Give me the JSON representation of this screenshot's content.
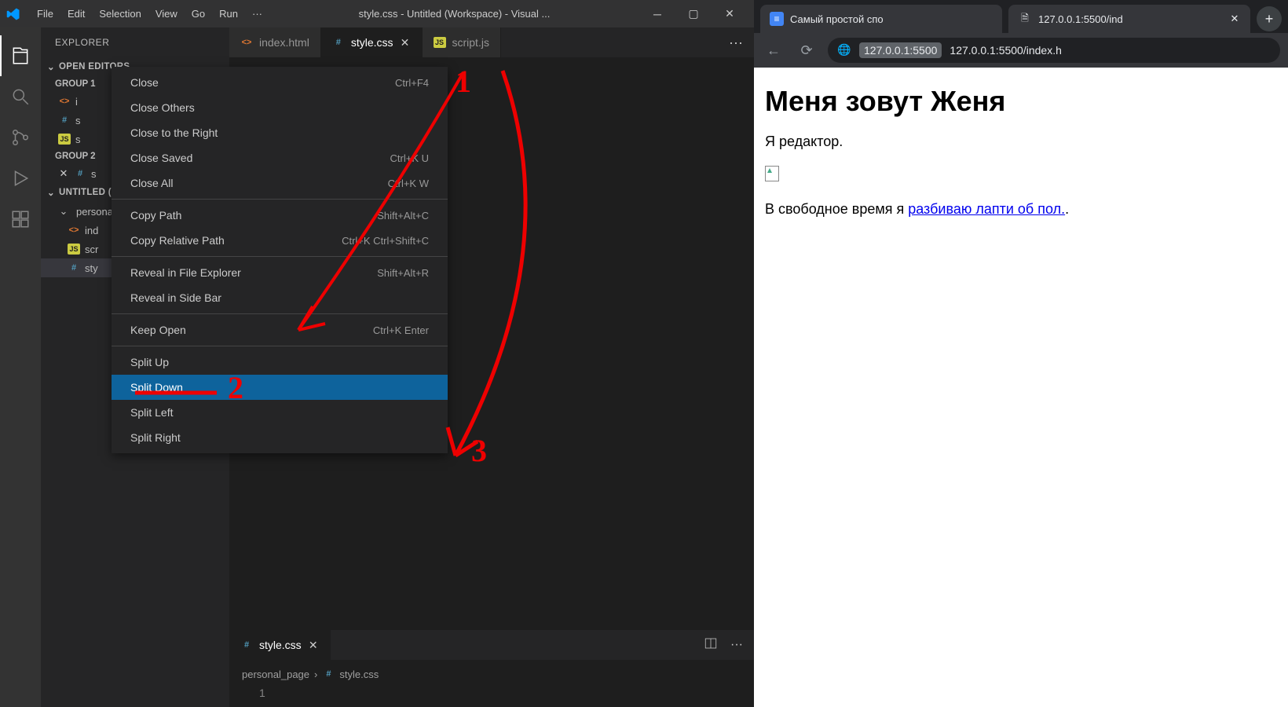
{
  "vscode": {
    "menubar": [
      "File",
      "Edit",
      "Selection",
      "View",
      "Go",
      "Run",
      "···"
    ],
    "title": "style.css - Untitled (Workspace) - Visual ...",
    "sidebar": {
      "title": "EXPLORER",
      "open_editors": "OPEN EDITORS",
      "group1": "GROUP 1",
      "group2": "GROUP 2",
      "workspace": "UNTITLED (WORKSPACE)",
      "folder": "personal_page",
      "files_g1": [
        {
          "name": "index.html",
          "type": "html",
          "short": "i"
        },
        {
          "name": "style.css",
          "type": "css",
          "short": "s"
        },
        {
          "name": "script.js",
          "type": "js",
          "short": "s"
        }
      ],
      "files_g2": [
        {
          "name": "style.css",
          "type": "css",
          "short": "s"
        }
      ],
      "tree": [
        {
          "name": "index.html",
          "type": "html",
          "short": "ind"
        },
        {
          "name": "script.js",
          "type": "js",
          "short": "scr"
        },
        {
          "name": "style.css",
          "type": "css",
          "short": "sty"
        }
      ]
    },
    "tabs": [
      {
        "name": "index.html",
        "type": "html",
        "active": false
      },
      {
        "name": "style.css",
        "type": "css",
        "active": true
      },
      {
        "name": "script.js",
        "type": "js",
        "active": false
      }
    ],
    "context_menu": [
      {
        "label": "Close",
        "shortcut": "Ctrl+F4"
      },
      {
        "label": "Close Others",
        "shortcut": ""
      },
      {
        "label": "Close to the Right",
        "shortcut": ""
      },
      {
        "label": "Close Saved",
        "shortcut": "Ctrl+K U"
      },
      {
        "label": "Close All",
        "shortcut": "Ctrl+K W"
      },
      {
        "sep": true
      },
      {
        "label": "Copy Path",
        "shortcut": "Shift+Alt+C"
      },
      {
        "label": "Copy Relative Path",
        "shortcut": "Ctrl+K Ctrl+Shift+C"
      },
      {
        "sep": true
      },
      {
        "label": "Reveal in File Explorer",
        "shortcut": "Shift+Alt+R"
      },
      {
        "label": "Reveal in Side Bar",
        "shortcut": ""
      },
      {
        "sep": true
      },
      {
        "label": "Keep Open",
        "shortcut": "Ctrl+K Enter"
      },
      {
        "sep": true
      },
      {
        "label": "Split Up",
        "shortcut": ""
      },
      {
        "label": "Split Down",
        "shortcut": "",
        "highlighted": true
      },
      {
        "label": "Split Left",
        "shortcut": ""
      },
      {
        "label": "Split Right",
        "shortcut": ""
      }
    ],
    "bottom": {
      "tab": "style.css",
      "breadcrumb": [
        "personal_page",
        "style.css"
      ],
      "line": "1"
    }
  },
  "browser": {
    "tabs": [
      {
        "label": "Самый простой спо",
        "fav": "docs"
      },
      {
        "label": "127.0.0.1:5500/ind",
        "fav": "page",
        "close": true
      }
    ],
    "url_host": "127.0.0.1:5500",
    "url_rest": "127.0.0.1:5500/index.h",
    "page": {
      "h1": "Меня зовут Женя",
      "p1": "Я редактор.",
      "p2_pre": "В свободное время я ",
      "p2_link": "разбиваю лапти об пол.",
      "p2_post": "."
    }
  },
  "annotations": {
    "n1": "1",
    "n2": "2",
    "n3": "3"
  }
}
